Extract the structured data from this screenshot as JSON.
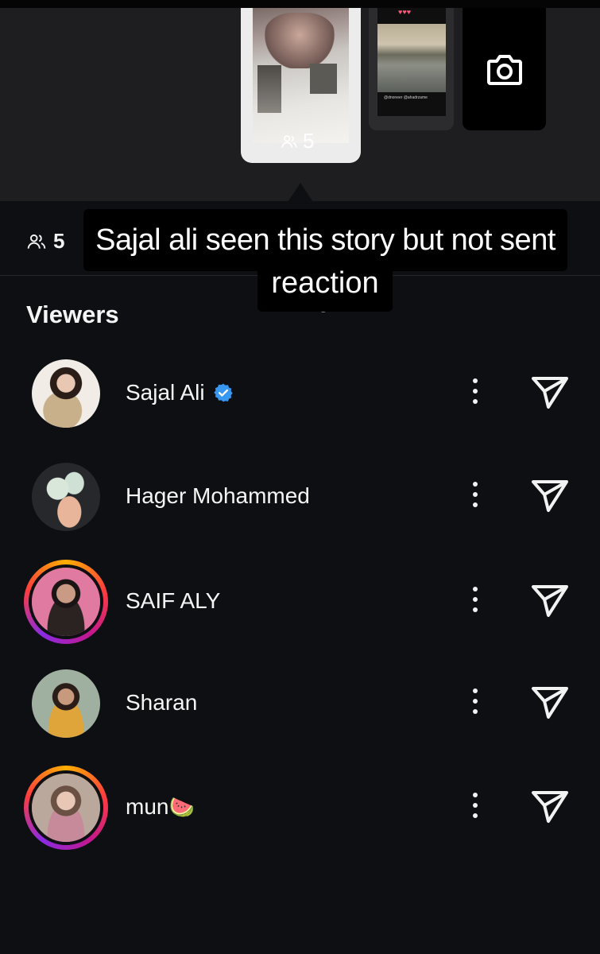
{
  "story_strip": {
    "main_views": "5",
    "second_thumb_tag": "@dnoneer @ahadrzame",
    "camera_icon": "camera-icon"
  },
  "viewer_count": "5",
  "caption": {
    "line1": "Sajal ali seen this story but not sent a",
    "line2": "reaction"
  },
  "section_title": "Viewers",
  "viewers": [
    {
      "name": "Sajal Ali",
      "verified": true,
      "ring": false
    },
    {
      "name": "Hager Mohammed",
      "verified": false,
      "ring": false
    },
    {
      "name": "SAIF ALY",
      "verified": false,
      "ring": true
    },
    {
      "name": "Sharan",
      "verified": false,
      "ring": false
    },
    {
      "name": "mun",
      "emoji": "🍉",
      "verified": false,
      "ring": true
    }
  ],
  "colors": {
    "background": "#0d0f13",
    "strip": "#1e1e20",
    "verified": "#3897f0"
  }
}
